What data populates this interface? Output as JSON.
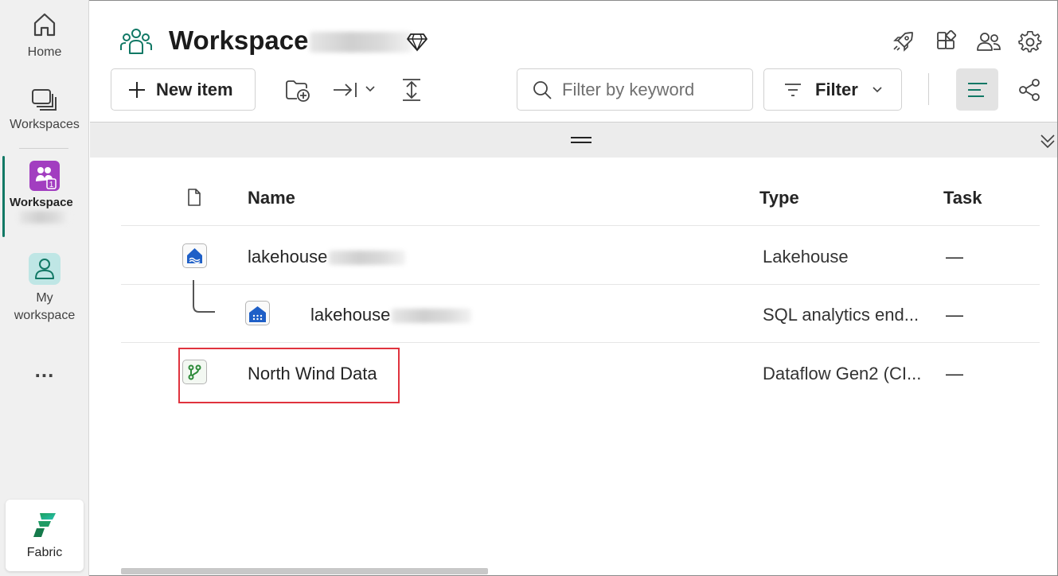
{
  "nav": {
    "home_label": "Home",
    "workspaces_label": "Workspaces",
    "workspace_label": "Workspace",
    "workspace_badge": "1",
    "my_workspace_label": "My workspace",
    "more_label": "...",
    "fabric_label": "Fabric"
  },
  "header": {
    "workspace_title": "Workspace"
  },
  "toolbar": {
    "new_item_label": "New item",
    "search_placeholder": "Filter by keyword",
    "filter_label": "Filter"
  },
  "table": {
    "columns": [
      "Name",
      "Type",
      "Task"
    ],
    "rows": [
      {
        "name": "lakehouse",
        "type": "Lakehouse",
        "task": "—",
        "icon": "lakehouse-icon"
      },
      {
        "name": "lakehouse",
        "type": "SQL analytics end...",
        "task": "—",
        "icon": "sql-endpoint-icon"
      },
      {
        "name": "North Wind Data",
        "type": "Dataflow Gen2 (CI...",
        "task": "—",
        "icon": "dataflow-icon"
      }
    ]
  },
  "colors": {
    "accent": "#117865",
    "workspace_tile": "#a23ec0",
    "highlight": "#e0333e"
  }
}
